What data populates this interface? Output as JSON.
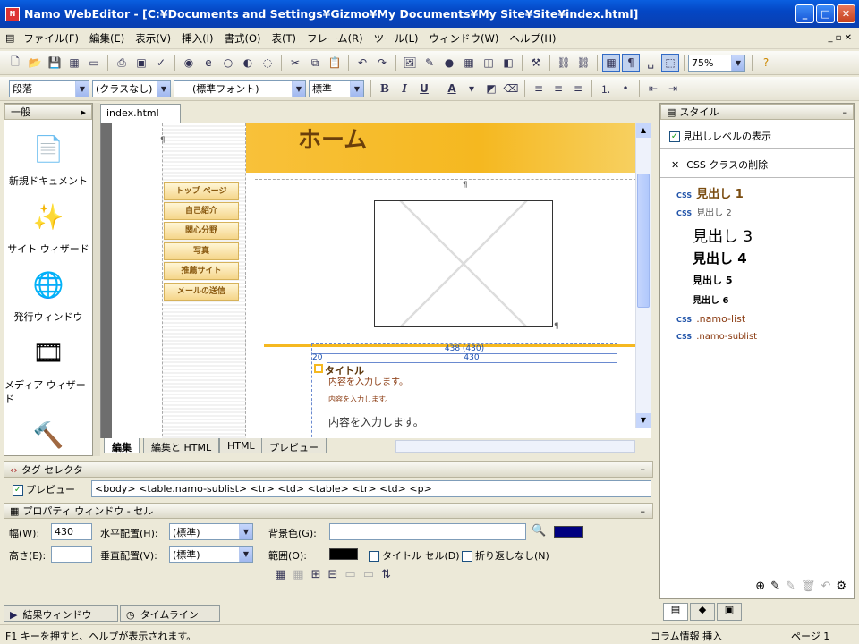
{
  "window": {
    "title": "Namo WebEditor - [C:¥Documents and Settings¥Gizmo¥My Documents¥My Site¥Site¥index.html]"
  },
  "menu": [
    "ファイル(F)",
    "編集(E)",
    "表示(V)",
    "挿入(I)",
    "書式(O)",
    "表(T)",
    "フレーム(R)",
    "ツール(L)",
    "ウィンドウ(W)",
    "ヘルプ(H)"
  ],
  "toolbar2": {
    "zoom": "75%"
  },
  "format": {
    "paragraph": "段落",
    "class": "(クラスなし)",
    "font": "(標準フォント)",
    "size": "標準"
  },
  "left_panel": {
    "header": "一般",
    "items": [
      {
        "label": "新規ドキュメント",
        "icon": "new-document-icon"
      },
      {
        "label": "サイト ウィザード",
        "icon": "site-wizard-icon"
      },
      {
        "label": "発行ウィンドウ",
        "icon": "publish-window-icon"
      },
      {
        "label": "メディア ウィザード",
        "icon": "media-wizard-icon"
      }
    ]
  },
  "document": {
    "tab": "index.html",
    "page_heading": "ホーム",
    "nav": [
      "トップ ページ",
      "自己紹介",
      "関心分野",
      "写真",
      "推薦サイト",
      "メールの送信"
    ],
    "table_width_label": "438 (430)",
    "cell_width_label": "430",
    "left_margin_label": "20",
    "title_text": "タイトル",
    "para_mark": "¶",
    "content_line_1": "内容を入力します。",
    "content_line_2": "内容を入力します。",
    "content_line_3": "内容を入力します。"
  },
  "view_tabs": [
    "編集",
    "編集と HTML",
    "HTML",
    "プレビュー"
  ],
  "style_panel": {
    "header": "スタイル",
    "show_heading_level": "見出しレベルの表示",
    "delete_css": "CSS クラスの削除",
    "css_prefix": "CSS",
    "headings": [
      "見出し 1",
      "見出し 2",
      "見出し 3",
      "見出し 4",
      "見出し 5",
      "見出し 6"
    ],
    "classes": [
      ".namo-list",
      ".namo-sublist"
    ]
  },
  "tag_selector": {
    "header": "タグ セレクタ",
    "preview_label": "プレビュー",
    "path": "<body> <table.namo-sublist> <tr> <td> <table> <tr> <td> <p>"
  },
  "properties": {
    "header": "プロパティ ウィンドウ - セル",
    "width_label": "幅(W):",
    "width_value": "430",
    "height_label": "高さ(E):",
    "halign_label": "水平配置(H):",
    "halign_value": "(標準)",
    "valign_label": "垂直配置(V):",
    "valign_value": "(標準)",
    "bgcolor_label": "背景色(G):",
    "border_label": "範囲(O):",
    "title_cell": "タイトル セル(D)",
    "nowrap": "折り返しなし(N)"
  },
  "result_tabs": [
    "結果ウィンドウ",
    "タイムライン"
  ],
  "status": {
    "help": "F1 キーを押すと、ヘルプが表示されます。",
    "mode": "コラム情報 挿入",
    "page": "ページ 1"
  },
  "colors": {
    "accent": "#0a3fb0",
    "nav_fill": "#f5d58a",
    "header_band": "#f5b820",
    "bg_swatch": "#000080"
  }
}
